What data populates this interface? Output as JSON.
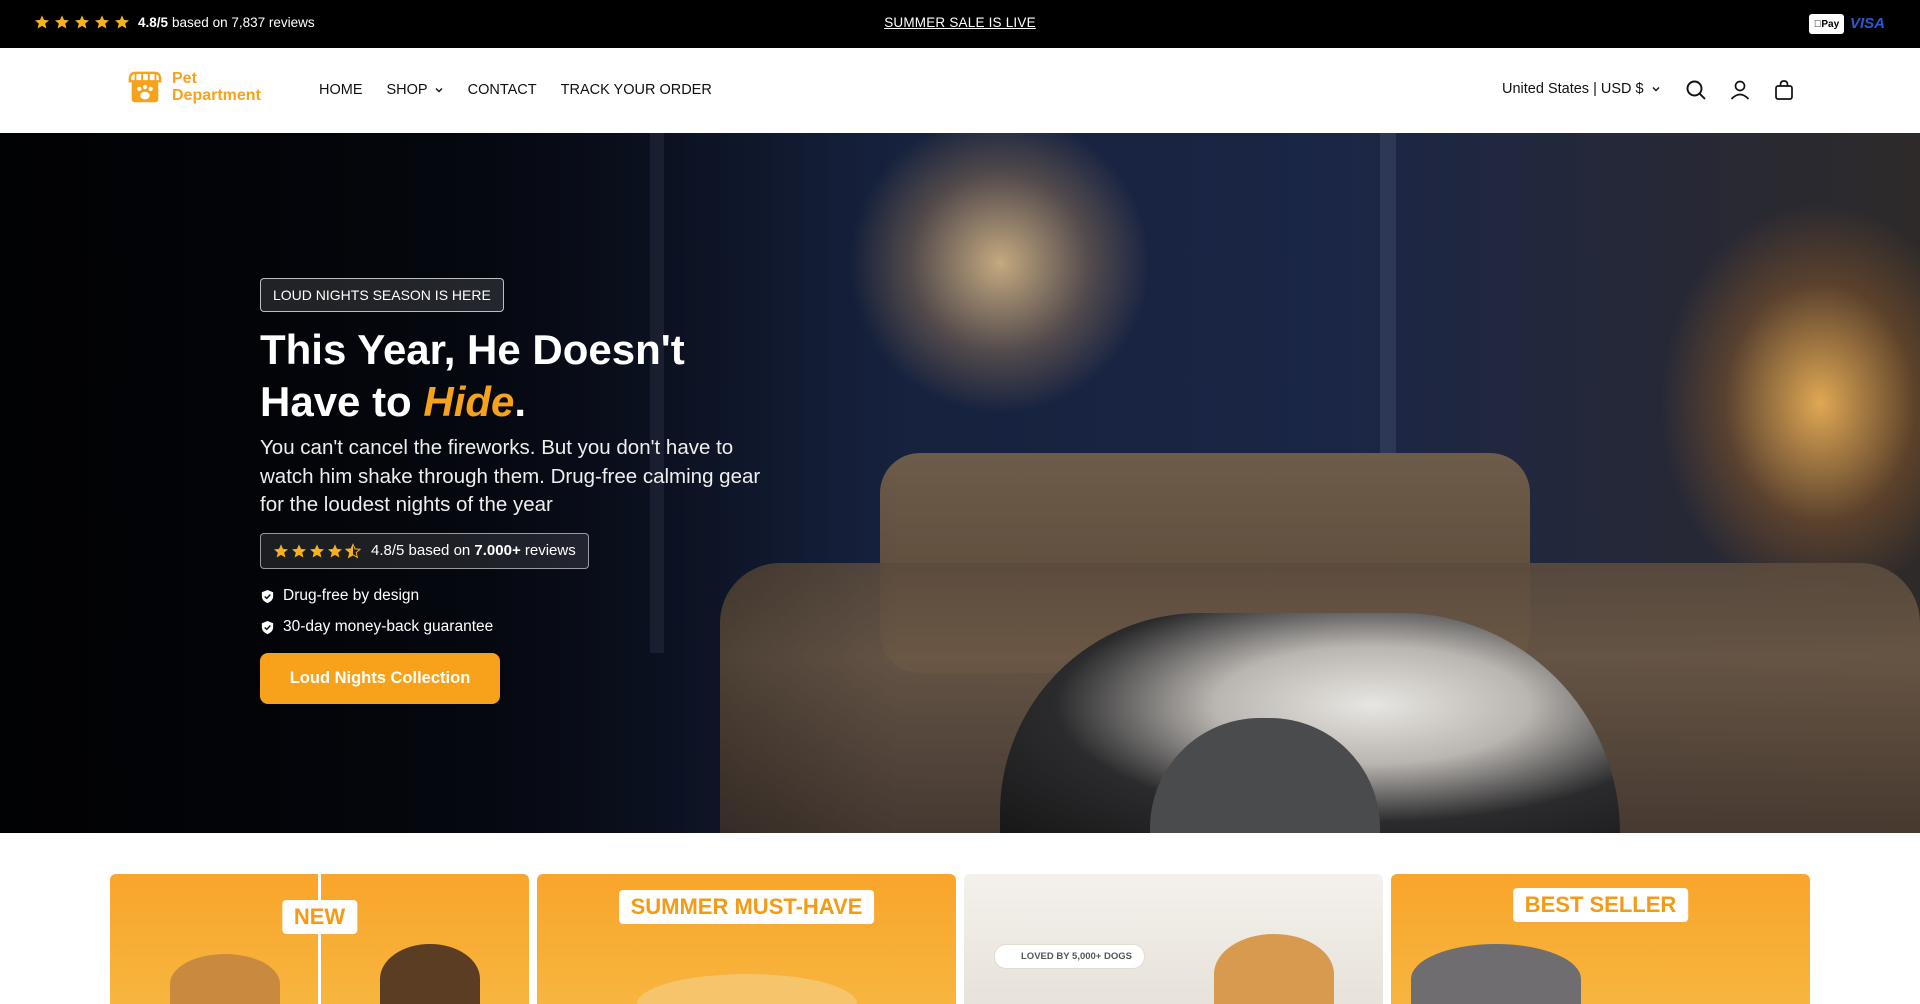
{
  "topbar": {
    "rating_score": "4.8/5",
    "rating_text": "based on 7,837 reviews",
    "sale_text": "SUMMER SALE IS LIVE",
    "applepay_label": "Pay",
    "visa_label": "VISA",
    "star_color": "#f6b21c"
  },
  "header": {
    "logo_line1": "Pet",
    "logo_line2": "Department",
    "nav": {
      "home": "HOME",
      "shop": "SHOP",
      "contact": "CONTACT",
      "track": "TRACK YOUR ORDER"
    },
    "locale": "United States | USD $",
    "icons": [
      "search-icon",
      "account-icon",
      "cart-icon"
    ]
  },
  "hero": {
    "eyebrow": "LOUD NIGHTS SEASON IS HERE",
    "title_part1": "This Year, He Doesn't Have to ",
    "title_highlight": "Hide",
    "title_end": ".",
    "subtitle": "You can't cancel the fireworks. But you don't have to watch him shake through them. Drug-free calming gear for the loudest nights of the year",
    "review_prefix": "4.8/5 based on ",
    "review_count": "7.000+",
    "review_suffix": " reviews",
    "rating_stars": 4.5,
    "bullets": [
      "Drug-free by design",
      "30-day money-back guarantee"
    ],
    "cta": "Loud Nights Collection",
    "accent": "#f8a21b"
  },
  "cards": {
    "c1_badge": "NEW",
    "c2_badge": "SUMMER MUST-HAVE",
    "c3_pill": "LOVED BY 5,000+ DOGS",
    "c4_badge": "BEST SELLER"
  }
}
